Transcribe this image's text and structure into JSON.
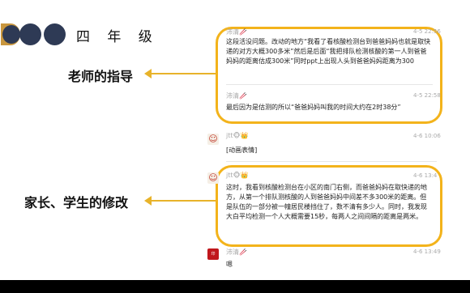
{
  "header": {
    "grade_title": "四 年 级"
  },
  "labels": {
    "teacher_guidance": "老师的指导",
    "parents_students_revision": "家长、学生的修改"
  },
  "messages": [
    {
      "name": "沛清🥢",
      "time": "4-5 22:56",
      "text": "这段活没问题。改动的地方“我看了看核酸检测台到爸爸妈妈也就是取快递的对方大概300多米”然后是后面“我把排队检测核酸的第一人到爸爸妈妈的距离估成300米”同时ppt上出现人头到爸爸妈妈距离为300"
    },
    {
      "name": "沛清🥢",
      "time": "4-5 22:58",
      "text": "最后因为是估测的所以“爸爸妈妈叫我的时间大约在2时38分”"
    },
    {
      "name": "jtt🐵👑",
      "time": "4-6 10:06",
      "text": "[动画表情]"
    },
    {
      "name": "jtt🐵👑",
      "time": "4-6 13:4",
      "text": "这时，我看到核酸检测台在小区的南门右侧，而爸爸妈妈在取快递的地方，从第一个排队测核酸的人到爸爸妈妈中间差不多300米的距离。但是队伍的一部分被一幢居民楼挡住了，数不清有多少人。同时，我发现大白平均检测一个人大概需要15秒，每两人之间间隔的距离是两米。"
    },
    {
      "name": "沛清🥢",
      "time": "4-6 13:49",
      "text": "嗯"
    }
  ],
  "colors": {
    "accent": "#f3b31b",
    "navy": "#2e3a55"
  },
  "icons": {
    "jtt_avatar": "person-avatar-icon",
    "peiqing_avatar": "red-seal-avatar-icon"
  }
}
